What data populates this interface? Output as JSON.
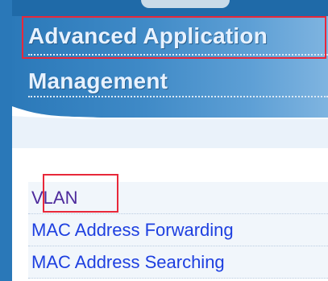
{
  "header": {
    "title_line1": "Advanced Application",
    "title_line2": "Management"
  },
  "menu": {
    "items": [
      {
        "label": "VLAN"
      },
      {
        "label": "MAC Address Forwarding"
      },
      {
        "label": "MAC Address Searching"
      }
    ]
  },
  "colors": {
    "header_blue": "#3e89c6",
    "link_blue": "#1d3fe0",
    "visited_purple": "#4d2a9c",
    "highlight_red": "#e8283a"
  }
}
